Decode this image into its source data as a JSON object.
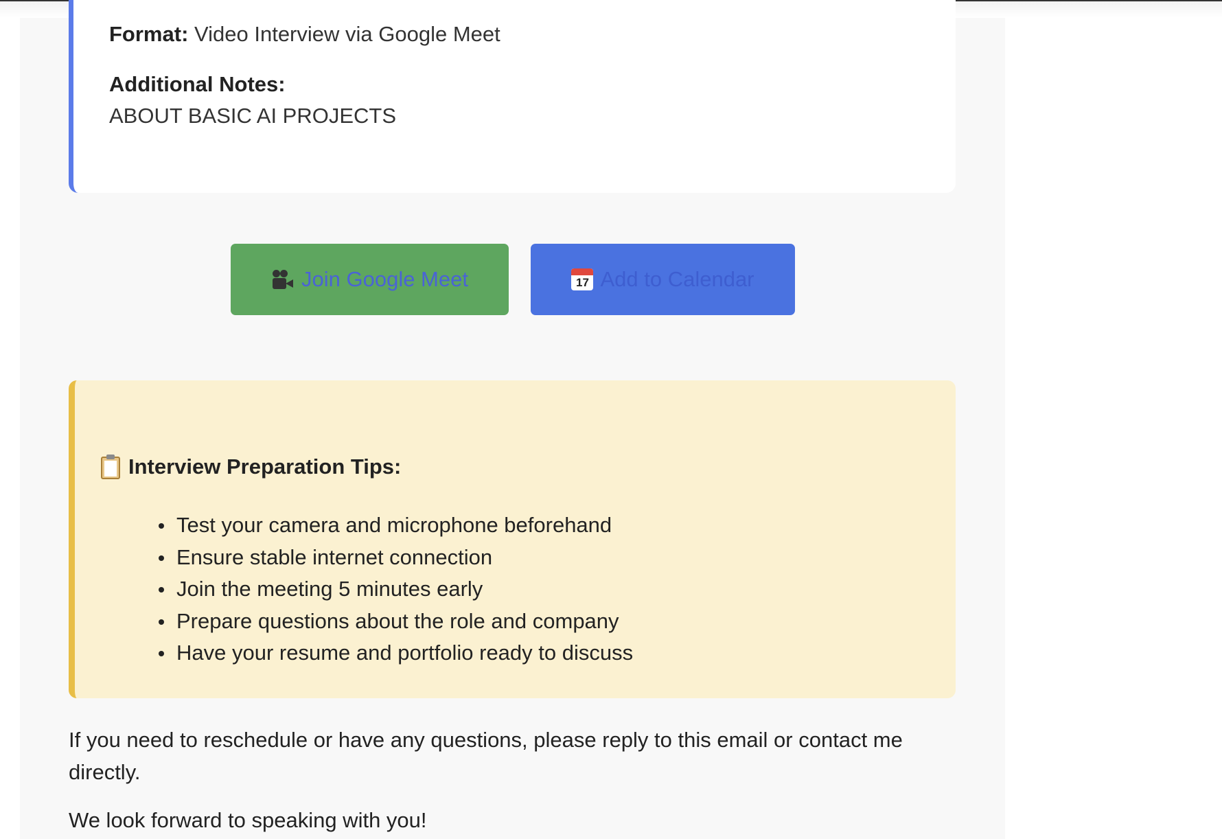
{
  "interview_details": {
    "format_label": "Format:",
    "format_value": "Video Interview via Google Meet",
    "notes_label": "Additional Notes:",
    "notes_value": "ABOUT BASIC AI PROJECTS"
  },
  "actions": {
    "meet_label": "Join Google Meet",
    "meet_icon": "movie-camera-icon",
    "calendar_label": "Add to Calendar",
    "calendar_icon": "calendar-icon",
    "calendar_icon_day": "17",
    "meet_color": "#5ea65f",
    "calendar_color": "#4a72e0"
  },
  "tips": {
    "title": "Interview Preparation Tips:",
    "icon": "clipboard-icon",
    "items": [
      "Test your camera and microphone beforehand",
      "Ensure stable internet connection",
      "Join the meeting 5 minutes early",
      "Prepare questions about the role and company",
      "Have your resume and portfolio ready to discuss"
    ]
  },
  "closing": {
    "reschedule_text": "If you need to reschedule or have any questions, please reply to this email or contact me directly.",
    "signoff_text": "We look forward to speaking with you!"
  }
}
